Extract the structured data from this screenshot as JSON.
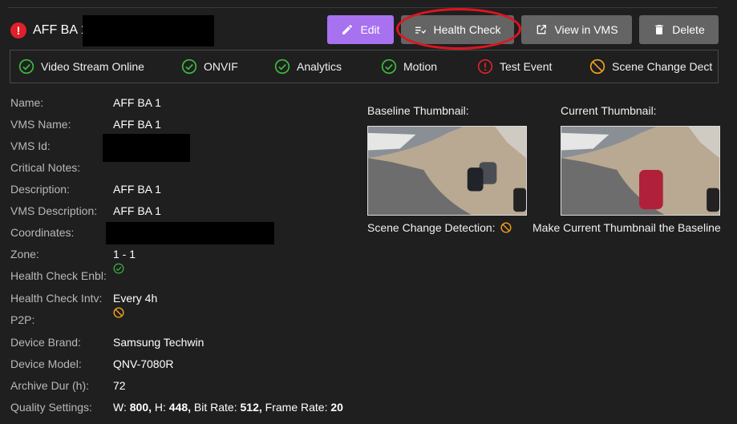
{
  "header": {
    "title": "AFF BA 1",
    "alert_glyph": "!"
  },
  "buttons": {
    "edit": "Edit",
    "health": "Health Check",
    "vms": "View in VMS",
    "delete": "Delete"
  },
  "status": [
    {
      "label": "Video Stream Online",
      "icon": "check-circle-icon",
      "color": "#3dbb3d"
    },
    {
      "label": "ONVIF",
      "icon": "check-circle-icon",
      "color": "#3dbb3d"
    },
    {
      "label": "Analytics",
      "icon": "check-circle-icon",
      "color": "#3dbb3d"
    },
    {
      "label": "Motion",
      "icon": "check-circle-icon",
      "color": "#3dbb3d"
    },
    {
      "label": "Test Event",
      "icon": "alert-circle-icon",
      "color": "#e0202a"
    },
    {
      "label": "Scene Change Dect",
      "icon": "block-icon",
      "color": "#f0a020"
    }
  ],
  "details": {
    "name_label": "Name:",
    "name": "AFF BA 1",
    "vms_name_label": "VMS Name:",
    "vms_name": "AFF BA 1",
    "vms_id_label": "VMS Id:",
    "critical_label": "Critical Notes:",
    "description_label": "Description:",
    "description": "AFF BA 1",
    "vms_desc_label": "VMS Description:",
    "vms_desc": "AFF BA 1",
    "coords_label": "Coordinates:",
    "zone_label": "Zone:",
    "zone": "1 - 1",
    "hc_enbl_label": "Health Check Enbl:",
    "hc_intv_label": "Health Check Intv:",
    "hc_intv": "Every 4h",
    "p2p_label": "P2P:",
    "brand_label": "Device Brand:",
    "brand": "Samsung Techwin",
    "model_label": "Device Model:",
    "model": "QNV-7080R",
    "archive_label": "Archive Dur (h):",
    "archive": "72",
    "quality_label": "Quality Settings:",
    "quality": {
      "w_label": "W:",
      "w": "800,",
      "h_label": "H:",
      "h": "448,",
      "br_label": "Bit Rate:",
      "br": "512,",
      "fr_label": "Frame Rate:",
      "fr": "20"
    }
  },
  "thumbnails": {
    "baseline_label": "Baseline Thumbnail:",
    "current_label": "Current Thumbnail:",
    "scene_label": "Scene Change Detection:",
    "make_baseline": "Make Current Thumbnail the Baseline"
  },
  "colors": {
    "edit_bg": "#a771f0",
    "button_bg": "#646464",
    "highlight_oval": "#e0141e",
    "ok": "#3dbb3d",
    "error": "#e0202a",
    "warn": "#f0a020"
  }
}
